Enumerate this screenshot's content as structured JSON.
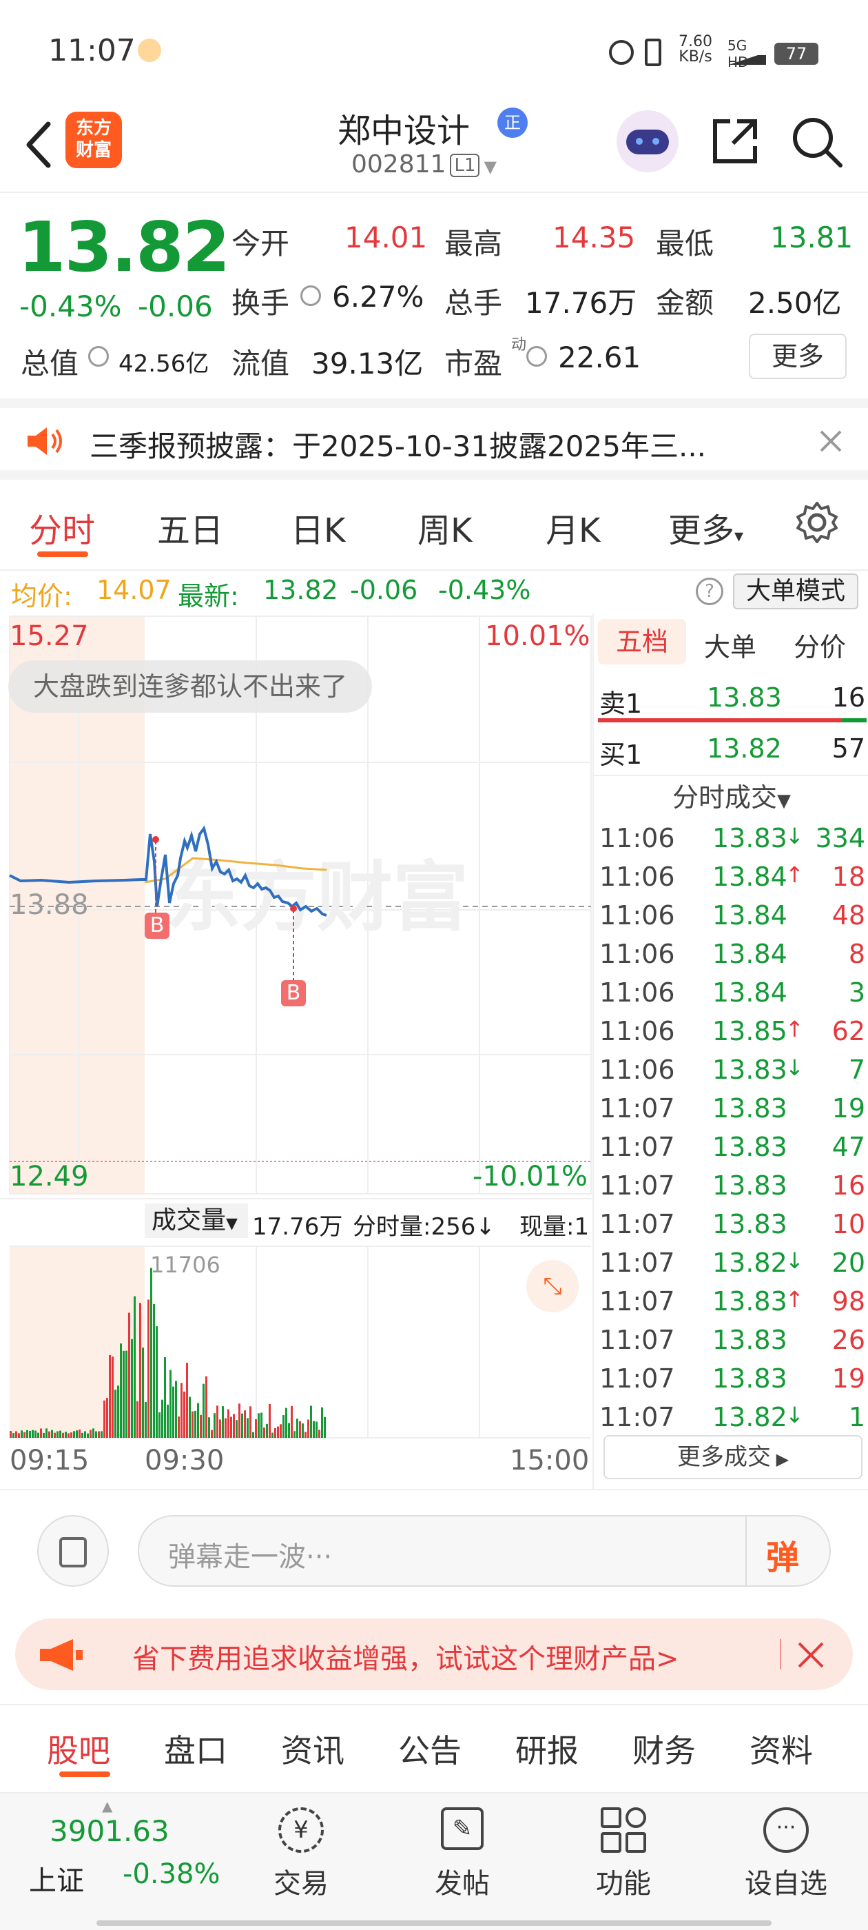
{
  "status_bar": {
    "time": "11:07",
    "net_speed": "7.60",
    "net_unit": "KB/s",
    "net_type": "5G HD",
    "battery": "77"
  },
  "header": {
    "logo_top": "东方",
    "logo_bottom": "财富",
    "stock_name": "郑中设计",
    "stock_badge": "正",
    "stock_code": "002811",
    "level": "L1"
  },
  "quote": {
    "price": "13.82",
    "change_pct": "-0.43%",
    "change": "-0.06",
    "open_label": "今开",
    "open": "14.01",
    "high_label": "最高",
    "high": "14.35",
    "low_label": "最低",
    "low": "13.81",
    "turnover_label": "换手",
    "turnover": "6.27%",
    "volume_label": "总手",
    "volume": "17.76万",
    "amount_label": "金额",
    "amount": "2.50亿",
    "mktcap_label": "总值",
    "mktcap": "42.56亿",
    "float_label": "流值",
    "float": "39.13亿",
    "pe_label": "市盈",
    "pe_sup": "动",
    "pe": "22.61",
    "more_label": "更多"
  },
  "notice": {
    "text": "三季报预披露：于2025-10-31披露2025年三..."
  },
  "chart_tabs": [
    "分时",
    "五日",
    "日K",
    "周K",
    "月K",
    "更多"
  ],
  "info_line": {
    "avg_label": "均价:",
    "avg": "14.07",
    "latest_label": "最新:",
    "latest": "13.82",
    "change": "-0.06",
    "change_pct": "-0.43%",
    "mode_label": "大单模式"
  },
  "chart": {
    "price_top": "15.27",
    "pct_top": "10.01%",
    "price_mid": "13.88",
    "price_bottom": "12.49",
    "pct_bottom": "-10.01%",
    "bubble": "大盘跌到连爹都认不出来了",
    "watermark": "东方财富",
    "marker": "B",
    "vol_label": "成交量",
    "vol_total": "17.76万",
    "vol_tick": "分时量:256↓",
    "vol_now": "现量:1",
    "vol_max": "11706",
    "time_start": "09:15",
    "time_open": "09:30",
    "time_end": "15:00"
  },
  "orderbook": {
    "tabs": [
      "五档",
      "大单",
      "分价"
    ],
    "sell1": {
      "label": "卖1",
      "price": "13.83",
      "qty": "16"
    },
    "buy1": {
      "label": "买1",
      "price": "13.82",
      "qty": "57"
    },
    "trades_title": "分时成交",
    "trades": [
      {
        "t": "11:06",
        "p": "13.83",
        "dir": "↓",
        "q": "334",
        "qc": "green"
      },
      {
        "t": "11:06",
        "p": "13.84",
        "dir": "↑",
        "q": "18",
        "qc": "red"
      },
      {
        "t": "11:06",
        "p": "13.84",
        "dir": "",
        "q": "48",
        "qc": "red"
      },
      {
        "t": "11:06",
        "p": "13.84",
        "dir": "",
        "q": "8",
        "qc": "red"
      },
      {
        "t": "11:06",
        "p": "13.84",
        "dir": "",
        "q": "3",
        "qc": "green"
      },
      {
        "t": "11:06",
        "p": "13.85",
        "dir": "↑",
        "q": "62",
        "qc": "red"
      },
      {
        "t": "11:06",
        "p": "13.83",
        "dir": "↓",
        "q": "7",
        "qc": "green"
      },
      {
        "t": "11:07",
        "p": "13.83",
        "dir": "",
        "q": "19",
        "qc": "green"
      },
      {
        "t": "11:07",
        "p": "13.83",
        "dir": "",
        "q": "47",
        "qc": "green"
      },
      {
        "t": "11:07",
        "p": "13.83",
        "dir": "",
        "q": "16",
        "qc": "red"
      },
      {
        "t": "11:07",
        "p": "13.83",
        "dir": "",
        "q": "10",
        "qc": "red"
      },
      {
        "t": "11:07",
        "p": "13.82",
        "dir": "↓",
        "q": "20",
        "qc": "green"
      },
      {
        "t": "11:07",
        "p": "13.83",
        "dir": "↑",
        "q": "98",
        "qc": "red"
      },
      {
        "t": "11:07",
        "p": "13.83",
        "dir": "",
        "q": "26",
        "qc": "red"
      },
      {
        "t": "11:07",
        "p": "13.83",
        "dir": "",
        "q": "19",
        "qc": "red"
      },
      {
        "t": "11:07",
        "p": "13.82",
        "dir": "↓",
        "q": "1",
        "qc": "green"
      }
    ],
    "more_trades": "更多成交"
  },
  "danmu": {
    "placeholder": "弹幕走一波···",
    "send": "弹"
  },
  "promo": {
    "text": "省下费用追求收益增强，试试这个理财产品>"
  },
  "bottom_tabs": [
    "股吧",
    "盘口",
    "资讯",
    "公告",
    "研报",
    "财务",
    "资料"
  ],
  "dock": {
    "index_value": "3901.63",
    "index_name": "上证",
    "index_pct": "-0.38%",
    "items": [
      "交易",
      "发帖",
      "功能",
      "设自选"
    ]
  },
  "colors": {
    "up": "#e4393c",
    "down": "#139a36",
    "accent": "#ff5a1f",
    "price_line": "#2f6fbf",
    "avg_line": "#f0b23c"
  }
}
